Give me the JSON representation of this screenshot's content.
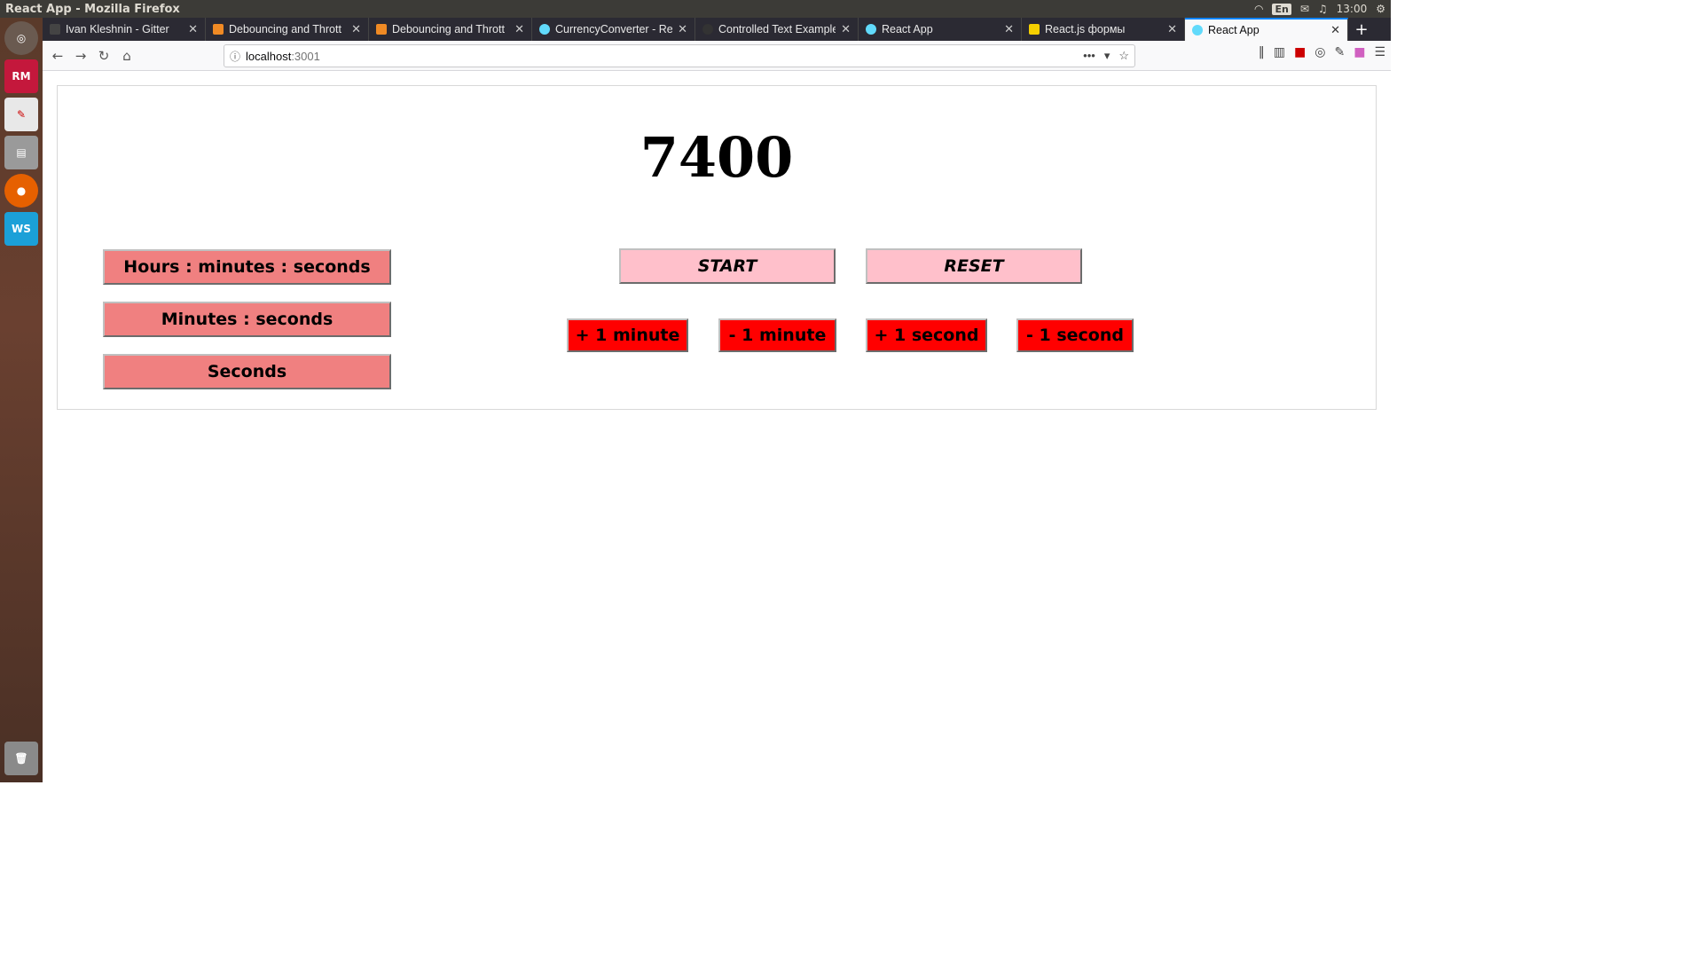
{
  "window": {
    "title": "React App - Mozilla Firefox"
  },
  "system_tray": {
    "lang": "En",
    "time": "13:00"
  },
  "launcher": {
    "items": [
      {
        "name": "ubuntu-dash-icon",
        "label": "",
        "color": "#e0e0e0"
      },
      {
        "name": "rubymine-icon",
        "label": "RM",
        "color": "#c4183c"
      },
      {
        "name": "text-editor-icon",
        "label": "",
        "color": "#e8e8e8"
      },
      {
        "name": "files-icon",
        "label": "",
        "color": "#9a9a9a"
      },
      {
        "name": "firefox-icon",
        "label": "",
        "color": "#e66000"
      },
      {
        "name": "webstorm-icon",
        "label": "WS",
        "color": "#1ba0d8"
      },
      {
        "name": "trash-icon",
        "label": "",
        "color": "#aaaaaa"
      }
    ]
  },
  "tabs": [
    {
      "label": "Ivan Kleshnin - Gitter",
      "favicon_color": "#444444",
      "active": false
    },
    {
      "label": "Debouncing and Thrott",
      "favicon_color": "#f08a24",
      "active": false
    },
    {
      "label": "Debouncing and Thrott",
      "favicon_color": "#f08a24",
      "active": false
    },
    {
      "label": "CurrencyConverter - Re",
      "favicon_color": "#61dafb",
      "active": false
    },
    {
      "label": "Controlled Text Example",
      "favicon_color": "#333333",
      "active": false
    },
    {
      "label": "React App",
      "favicon_color": "#61dafb",
      "active": false
    },
    {
      "label": "React.js формы",
      "favicon_color": "#f5d000",
      "active": false
    },
    {
      "label": "React App",
      "favicon_color": "#61dafb",
      "active": true
    }
  ],
  "urlbar": {
    "host": "localhost",
    "port": ":3001"
  },
  "timer": {
    "value": "7400"
  },
  "format_buttons": [
    {
      "label": "Hours : minutes : seconds"
    },
    {
      "label": "Minutes : seconds"
    },
    {
      "label": "Seconds"
    }
  ],
  "controls": {
    "start_label": "START",
    "reset_label": "RESET"
  },
  "adjust_buttons": [
    {
      "label": "+ 1 minute"
    },
    {
      "label": "- 1 minute"
    },
    {
      "label": "+ 1 second"
    },
    {
      "label": "- 1 second"
    }
  ],
  "colors": {
    "format_button": "#f08080",
    "control_button": "#ffc0cb",
    "adjust_button": "#ff0000"
  }
}
